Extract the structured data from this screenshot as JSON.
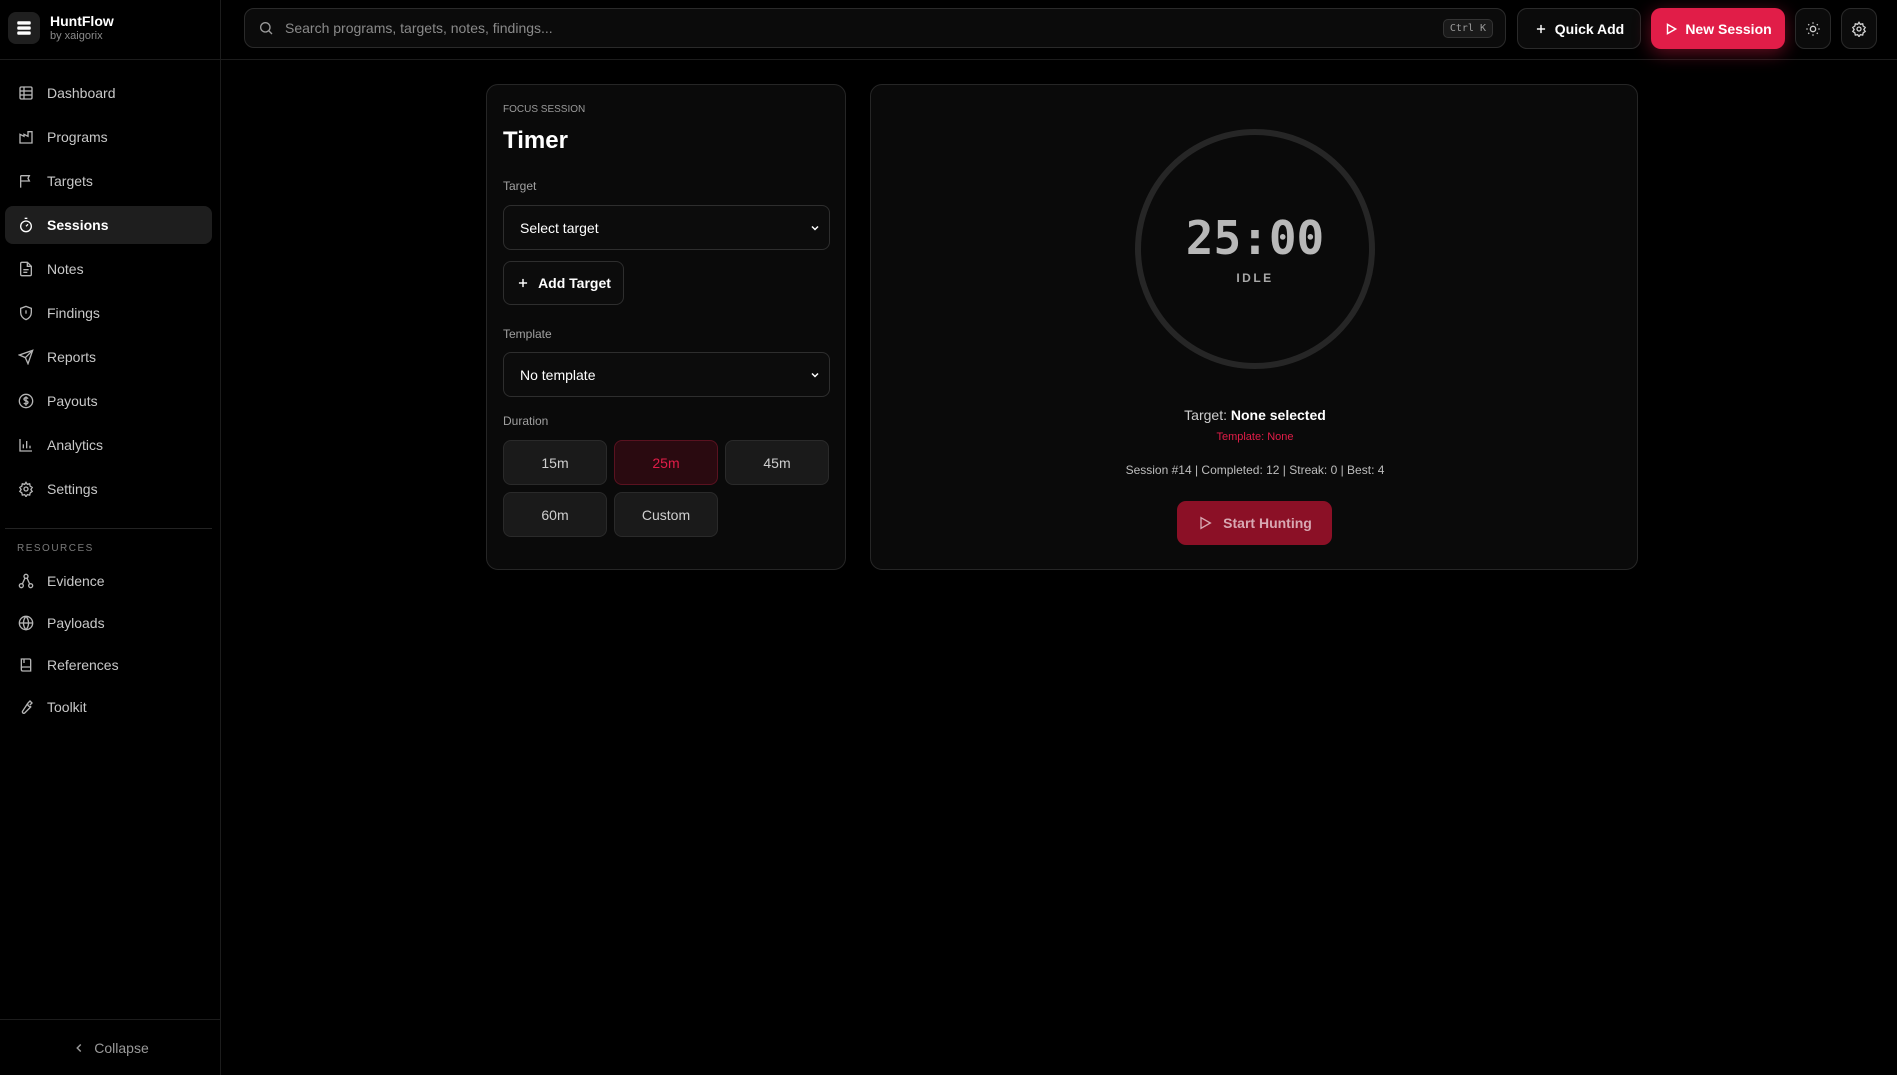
{
  "brand": {
    "title": "HuntFlow",
    "subtitle": "by xaigorix"
  },
  "nav": [
    {
      "label": "Dashboard",
      "icon": "grid-icon"
    },
    {
      "label": "Programs",
      "icon": "building-icon"
    },
    {
      "label": "Targets",
      "icon": "flag-icon"
    },
    {
      "label": "Sessions",
      "icon": "timer-icon",
      "active": true
    },
    {
      "label": "Notes",
      "icon": "file-icon"
    },
    {
      "label": "Findings",
      "icon": "shield-icon"
    },
    {
      "label": "Reports",
      "icon": "send-icon"
    },
    {
      "label": "Payouts",
      "icon": "dollar-icon"
    },
    {
      "label": "Analytics",
      "icon": "bar-chart-icon"
    },
    {
      "label": "Settings",
      "icon": "gear-icon"
    }
  ],
  "resources": {
    "label": "RESOURCES",
    "items": [
      {
        "label": "Evidence",
        "icon": "nodes-icon"
      },
      {
        "label": "Payloads",
        "icon": "globe-icon"
      },
      {
        "label": "References",
        "icon": "book-icon"
      },
      {
        "label": "Toolkit",
        "icon": "wrench-icon"
      }
    ]
  },
  "collapse_label": "Collapse",
  "search": {
    "placeholder": "Search programs, targets, notes, findings...",
    "shortcut": "Ctrl K"
  },
  "header": {
    "quick_add": "Quick Add",
    "new_session": "New Session"
  },
  "focus": {
    "eyebrow": "FOCUS SESSION",
    "title": "Timer",
    "target_label": "Target",
    "target_value": "Select target",
    "add_target": "Add Target",
    "template_label": "Template",
    "template_value": "No template",
    "duration_label": "Duration",
    "durations": [
      "15m",
      "25m",
      "45m",
      "60m",
      "Custom"
    ],
    "selected_duration": "25m"
  },
  "timer": {
    "time": "25:00",
    "state": "IDLE",
    "target_prefix": "Target:",
    "target_value": "None selected",
    "template_line": "Template: None",
    "stats_line": "Session #14 | Completed: 12 | Streak: 0 | Best: 4",
    "start_label": "Start Hunting"
  },
  "colors": {
    "accent": "#e11d48",
    "background": "#000000",
    "panel": "#0a0a0a"
  }
}
